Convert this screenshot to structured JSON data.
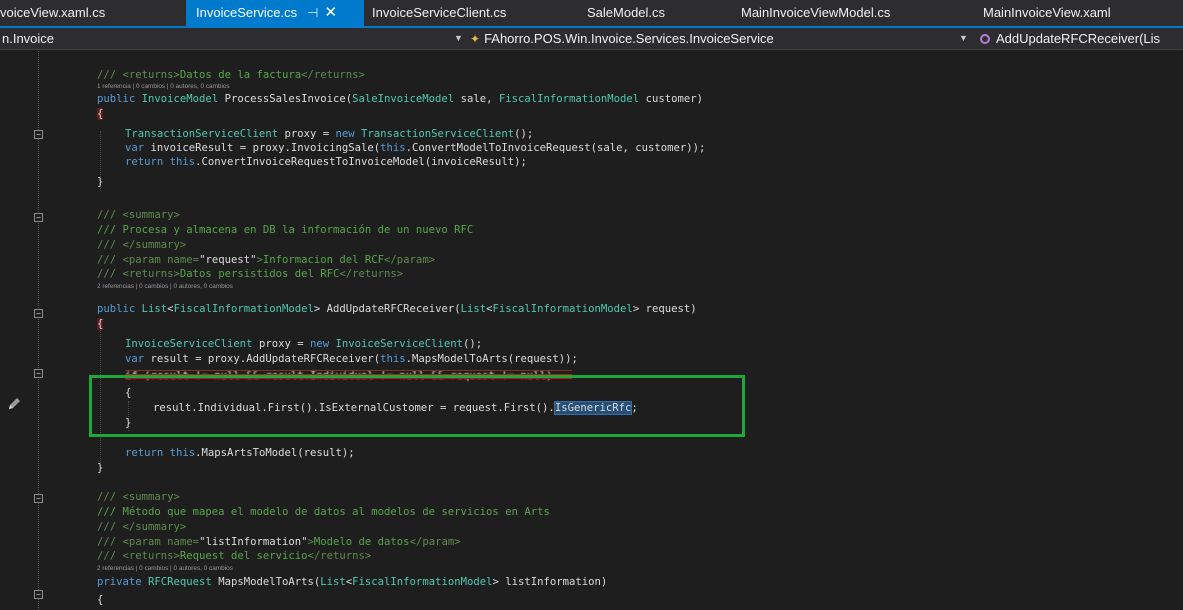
{
  "tabs": [
    {
      "label": "voiceView.xaml.cs",
      "active": false
    },
    {
      "label": "InvoiceService.cs",
      "active": true,
      "pin_icon": "pin-icon",
      "close_icon": "close-icon"
    },
    {
      "label": "InvoiceServiceClient.cs",
      "active": false
    },
    {
      "label": "SaleModel.cs",
      "active": false
    },
    {
      "label": "MainInvoiceViewModel.cs",
      "active": false
    },
    {
      "label": "MainInvoiceView.xaml",
      "active": false
    }
  ],
  "navbar": {
    "project": "n.Invoice",
    "type": "FAhorro.POS.Win.Invoice.Services.InvoiceService",
    "member": "AddUpdateRFCReceiver(Lis"
  },
  "code": {
    "l0": {
      "a": "/// <returns>",
      "b": "Datos de la factura",
      "c": "</returns>"
    },
    "lens1": "1 referencia | 0 cambios | 0 autores, 0 cambios",
    "l1": {
      "kw": "public ",
      "t1": "InvoiceModel",
      "m": " ProcessSalesInvoice(",
      "t2": "SaleInvoiceModel",
      "p1": " sale, ",
      "t3": "FiscalInformationModel",
      "p2": " customer)"
    },
    "l2": "{",
    "l3": {
      "t": "TransactionServiceClient",
      "a": " proxy = ",
      "kw": "new ",
      "t2": "TransactionServiceClient",
      "b": "();"
    },
    "l4": {
      "kw": "var",
      "a": " invoiceResult = proxy.InvoicingSale(",
      "th": "this",
      "b": ".ConvertModelToInvoiceRequest(sale, customer));"
    },
    "l5": {
      "kw": "return ",
      "th": "this",
      "b": ".ConvertInvoiceRequestToInvoiceModel(invoiceResult);"
    },
    "l6": "}",
    "l7": {
      "a": "/// ",
      "b": "<summary>"
    },
    "l8": {
      "a": "/// Procesa y almacena en DB la información de un nuevo RFC"
    },
    "l9": {
      "a": "/// ",
      "b": "</summary>"
    },
    "l10": {
      "a": "/// ",
      "b": "<param name=",
      "c": "\"request\"",
      "d": ">",
      "e": "Informacion del RCF",
      "f": "</param>"
    },
    "l11": {
      "a": "/// ",
      "b": "<returns>",
      "c": "Datos persistidos del RFC",
      "d": "</returns>"
    },
    "lens2": "2 referencias | 0 cambios | 0 autores, 0 cambios",
    "l12": {
      "kw": "public ",
      "t1": "List",
      "a": "<",
      "t2": "FiscalInformationModel",
      "b": "> AddUpdateRFCReceiver(",
      "t3": "List",
      "c": "<",
      "t4": "FiscalInformationModel",
      "d": "> request)"
    },
    "l13": "{",
    "l14": {
      "t": "InvoiceServiceClient",
      "a": " proxy = ",
      "kw": "new ",
      "t2": "InvoiceServiceClient",
      "b": "();"
    },
    "l15": {
      "kw": "var",
      "a": " result = proxy.AddUpdateRFCReceiver(",
      "th": "this",
      "b": ".MapsModelToArts(request));"
    },
    "l16": "if (result != null && result.Individual != null && request != null)",
    "l17": "{",
    "l18": {
      "a": "result.Individual.First().IsExternalCustomer = request.First().",
      "sel": "IsGenericRfc",
      "b": ";"
    },
    "l19": "}",
    "l20": {
      "kw": "return ",
      "th": "this",
      "b": ".MapsArtsToModel(result);"
    },
    "l21": "}",
    "l22": {
      "a": "/// ",
      "b": "<summary>"
    },
    "l23": {
      "a": "/// Método que mapea el modelo de datos al modelos de servicios en Arts"
    },
    "l24": {
      "a": "/// ",
      "b": "</summary>"
    },
    "l25": {
      "a": "/// ",
      "b": "<param name=",
      "c": "\"listInformation\"",
      "d": ">",
      "e": "Modelo de datos",
      "f": "</param>"
    },
    "l26": {
      "a": "/// ",
      "b": "<returns>",
      "c": "Request del servicio",
      "d": "</returns>"
    },
    "lens3": "2 referencias | 0 cambios | 0 autores, 0 cambios",
    "l27": {
      "kw": "private ",
      "t1": "RFCRequest",
      "a": " MapsModelToArts(",
      "t2": "List",
      "b": "<",
      "t3": "FiscalInformationModel",
      "c": "> listInformation)"
    },
    "l28": "{"
  },
  "colors": {
    "accent": "#007acc",
    "highlight_box": "#1fa83a",
    "strike": "#b31b1b"
  }
}
